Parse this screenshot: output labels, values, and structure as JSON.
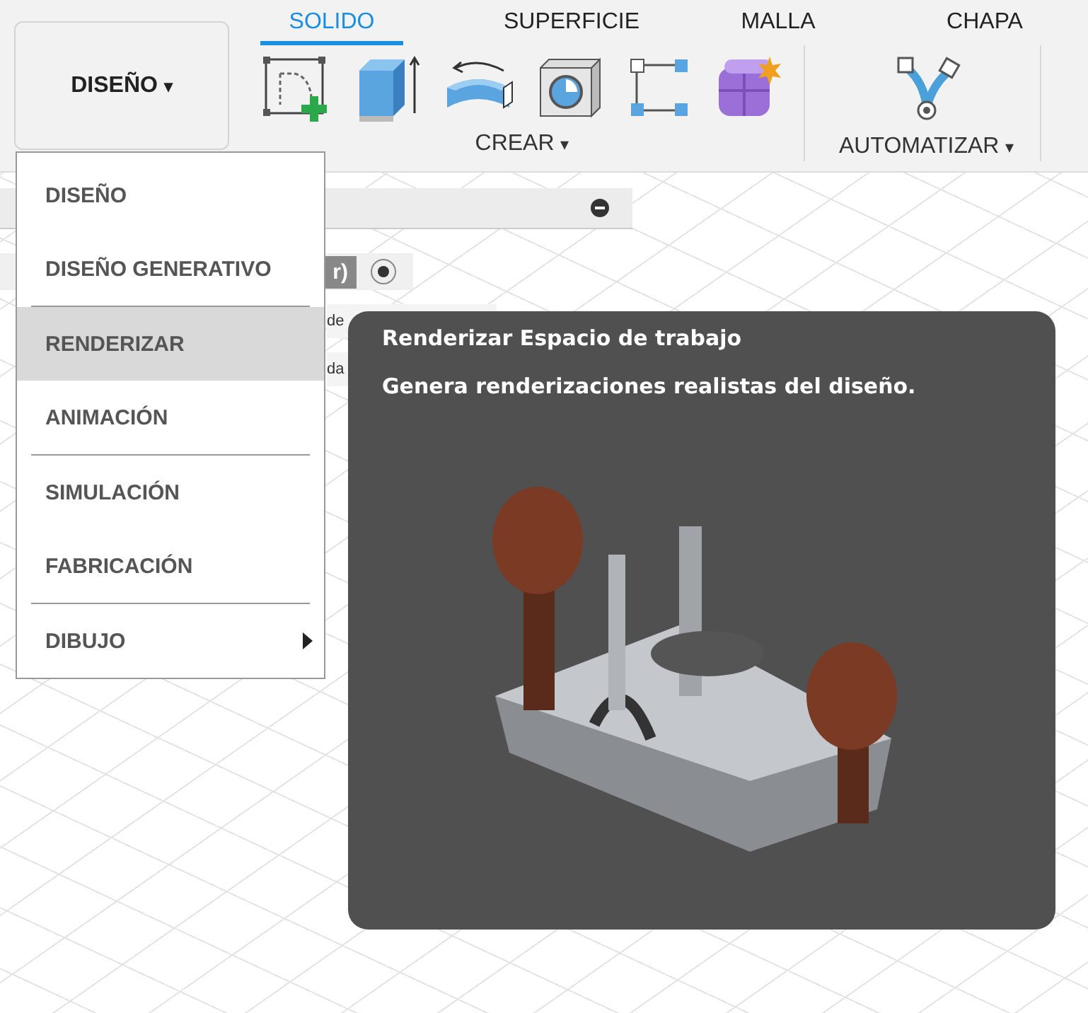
{
  "workspace_button": {
    "label": "DISEÑO",
    "caret": "▾"
  },
  "tabs": [
    {
      "label": "SOLIDO",
      "selected": true
    },
    {
      "label": "SUPERFICIE",
      "selected": false
    },
    {
      "label": "MALLA",
      "selected": false
    },
    {
      "label": "CHAPA",
      "selected": false
    }
  ],
  "tool_groups": [
    {
      "label": "CREAR",
      "caret": "▾"
    },
    {
      "label": "AUTOMATIZAR",
      "caret": "▾"
    }
  ],
  "browser": {
    "chip": "r)",
    "radio_checked": true,
    "rows": [
      "de",
      "da"
    ]
  },
  "workspace_menu": {
    "items": [
      {
        "label": "DISEÑO",
        "selected": false,
        "divider_after": false,
        "has_submenu": false
      },
      {
        "label": "DISEÑO GENERATIVO",
        "selected": false,
        "divider_after": true,
        "has_submenu": false
      },
      {
        "label": "RENDERIZAR",
        "selected": true,
        "divider_after": false,
        "has_submenu": false
      },
      {
        "label": "ANIMACIÓN",
        "selected": false,
        "divider_after": true,
        "has_submenu": false
      },
      {
        "label": "SIMULACIÓN",
        "selected": false,
        "divider_after": false,
        "has_submenu": false
      },
      {
        "label": "FABRICACIÓN",
        "selected": false,
        "divider_after": true,
        "has_submenu": false
      },
      {
        "label": "DIBUJO",
        "selected": false,
        "divider_after": false,
        "has_submenu": true
      }
    ]
  },
  "tooltip": {
    "title": "Renderizar Espacio de trabajo",
    "description": "Genera renderizaciones realistas del diseño."
  }
}
